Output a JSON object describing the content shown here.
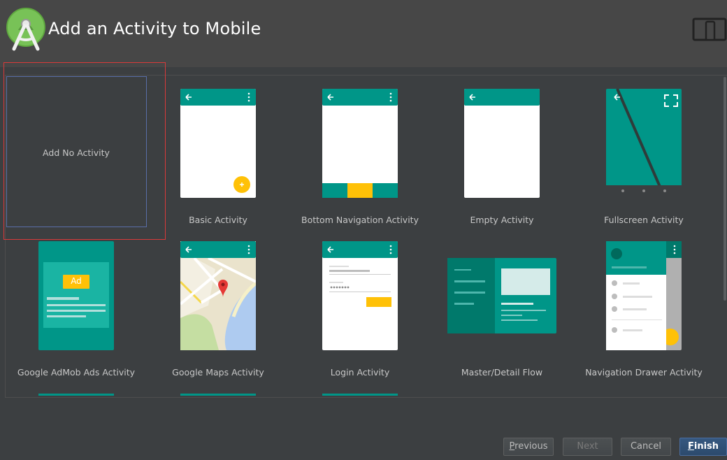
{
  "header": {
    "title": "Add an Activity to Mobile",
    "logo_icon": "android-studio-icon",
    "device_icon": "phone-tablet-icon"
  },
  "colors": {
    "teal": "#009688",
    "teal_dark": "#00796b",
    "accent": "#ffc107",
    "background": "#3c3f41",
    "header": "#474747",
    "selection": "#d93a3a"
  },
  "templates": [
    {
      "label": "Add No Activity"
    },
    {
      "label": "Basic Activity"
    },
    {
      "label": "Bottom Navigation Activity"
    },
    {
      "label": "Empty Activity"
    },
    {
      "label": "Fullscreen Activity"
    },
    {
      "label": "Google AdMob Ads Activity",
      "ad_badge": "Ad"
    },
    {
      "label": "Google Maps Activity"
    },
    {
      "label": "Login Activity"
    },
    {
      "label": "Master/Detail Flow"
    },
    {
      "label": "Navigation Drawer Activity"
    }
  ],
  "buttons": {
    "previous": {
      "mnemonic": "P",
      "rest": "revious"
    },
    "next": "Next",
    "cancel": "Cancel",
    "finish": {
      "mnemonic": "F",
      "rest": "inish"
    }
  }
}
